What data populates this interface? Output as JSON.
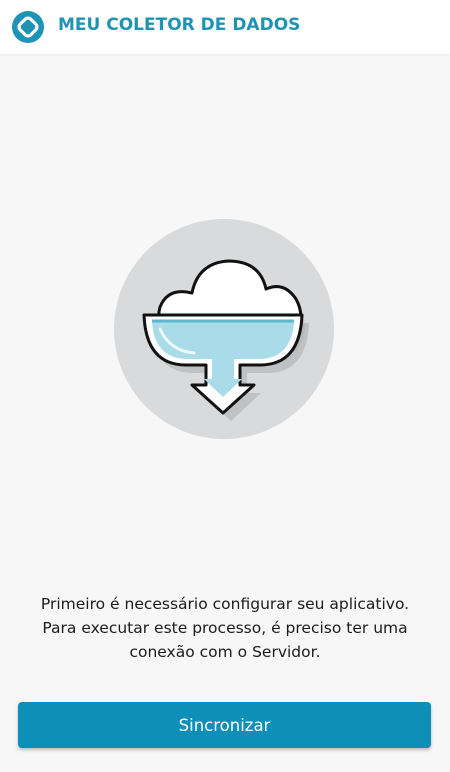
{
  "app_bar": {
    "logo_icon": "app-logo-icon",
    "title": "MEU COLETOR DE DADOS"
  },
  "illustration": {
    "icon": "cloud-download-icon"
  },
  "message": {
    "line1": "Primeiro é necessário configurar seu aplicativo.",
    "line2": "Para executar este processo, é preciso ter uma",
    "line3": "conexão com o Servidor."
  },
  "actions": {
    "sync_label": "Sincronizar"
  },
  "colors": {
    "brand": "#1f93b5",
    "button": "#0e8fb8",
    "background": "#f7f7f7",
    "illustration_circle": "#d9dadb",
    "water": "#a9dbe8"
  }
}
